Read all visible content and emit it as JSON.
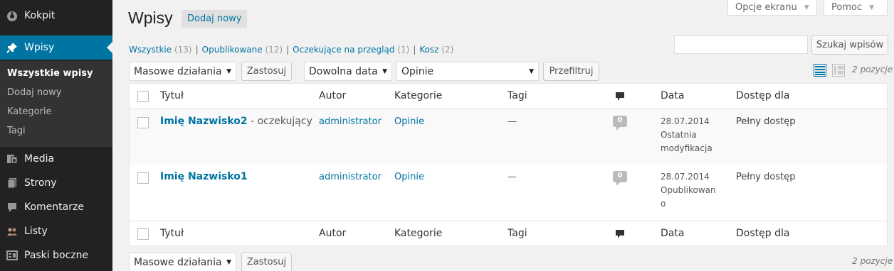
{
  "sidebar": {
    "items": [
      {
        "label": "Kokpit",
        "icon": "dashboard-icon"
      },
      {
        "label": "Wpisy",
        "icon": "pin-icon"
      },
      {
        "label": "Media",
        "icon": "media-icon"
      },
      {
        "label": "Strony",
        "icon": "pages-icon"
      },
      {
        "label": "Komentarze",
        "icon": "comments-icon"
      },
      {
        "label": "Listy",
        "icon": "users-icon"
      },
      {
        "label": "Paski boczne",
        "icon": "sidebars-icon"
      }
    ],
    "submenu": [
      "Wszystkie wpisy",
      "Dodaj nowy",
      "Kategorie",
      "Tagi"
    ]
  },
  "screen_tabs": {
    "options": "Opcje ekranu",
    "help": "Pomoc"
  },
  "header": {
    "title": "Wpisy",
    "add_new": "Dodaj nowy"
  },
  "views": [
    {
      "label": "Wszystkie",
      "count": "(13)"
    },
    {
      "label": "Opublikowane",
      "count": "(12)"
    },
    {
      "label": "Oczekujące na przegląd",
      "count": "(1)"
    },
    {
      "label": "Kosz",
      "count": "(2)"
    }
  ],
  "search": {
    "value": "",
    "button": "Szukaj wpisów"
  },
  "toolbar": {
    "bulk_action": "Masowe działania",
    "apply": "Zastosuj",
    "date_filter": "Dowolna data",
    "category_filter": "Opinie",
    "filter": "Przefiltruj",
    "items_count": "2 pozycje"
  },
  "table": {
    "columns": [
      "Tytuł",
      "Autor",
      "Kategorie",
      "Tagi",
      "Data",
      "Dostęp dla"
    ],
    "rows": [
      {
        "title": "Imię Nazwisko2",
        "state": " - oczekujący",
        "author": "administrator",
        "category": "Opinie",
        "tags": "—",
        "comments": "0",
        "date": "28.07.2014",
        "date_status_1": "Ostatnia",
        "date_status_2": "modyfikacja",
        "access": "Pełny dostęp"
      },
      {
        "title": "Imię Nazwisko1",
        "state": "",
        "author": "administrator",
        "category": "Opinie",
        "tags": "—",
        "comments": "0",
        "date": "28.07.2014",
        "date_status_1": "Opublikowan",
        "date_status_2": "o",
        "access": "Pełny dostęp"
      }
    ]
  },
  "colors": {
    "accent": "#0074a2",
    "sidebar": "#222222"
  }
}
